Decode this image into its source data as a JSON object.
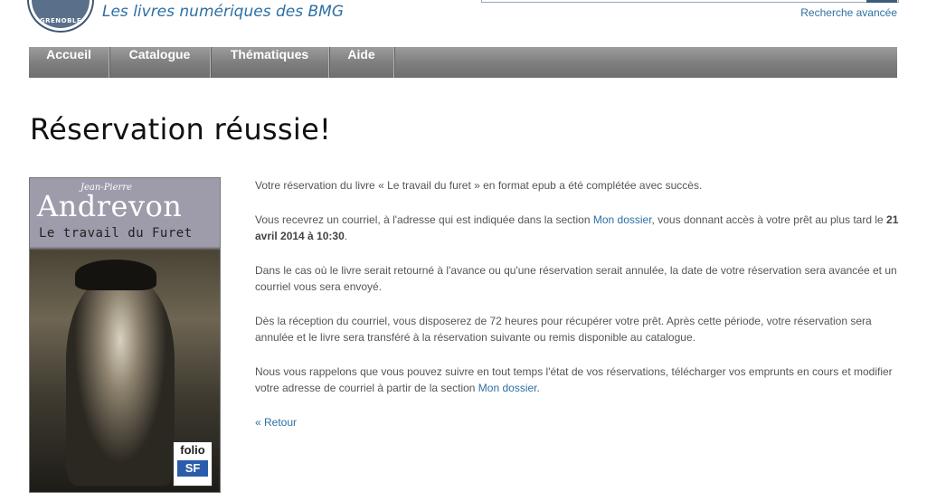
{
  "header": {
    "seal_text": "GRENOBLE",
    "tagline": "Les livres numériques des BMG",
    "advanced_search": "Recherche avancée"
  },
  "nav": {
    "items": [
      {
        "label": "Accueil"
      },
      {
        "label": "Catalogue"
      },
      {
        "label": "Thématiques"
      },
      {
        "label": "Aide"
      }
    ]
  },
  "page": {
    "title": "Réservation réussie!"
  },
  "cover": {
    "author_first": "Jean-Pierre",
    "author_last": "Andrevon",
    "title": "Le travail du Furet",
    "publisher_line1": "folio",
    "publisher_line2": "SF"
  },
  "content": {
    "p1": "Votre réservation du livre « Le travail du furet » en format epub a été complétée avec succès.",
    "p2_a": "Vous recevrez un courriel, à l'adresse qui est indiquée dans la section ",
    "p2_link": "Mon dossier",
    "p2_b": ", vous donnant accès à votre prêt au plus tard le ",
    "p2_date": "21 avril 2014 à 10:30",
    "p2_c": ".",
    "p3": "Dans le cas où le livre serait retourné à l'avance ou qu'une réservation serait annulée, la date de votre réservation sera avancée et un courriel vous sera envoyé.",
    "p4": "Dès la réception du courriel, vous disposerez de 72 heures pour récupérer votre prêt. Après cette période, votre réservation sera annulée et le livre sera transféré à la réservation suivante ou remis disponible au catalogue.",
    "p5_a": "Nous vous rappelons que vous pouvez suivre en tout temps l'état de vos réservations, télécharger vos emprunts en cours et modifier votre adresse de courriel à partir de la section ",
    "p5_link": "Mon dossier",
    "p5_b": ".",
    "back_link": "« Retour"
  }
}
